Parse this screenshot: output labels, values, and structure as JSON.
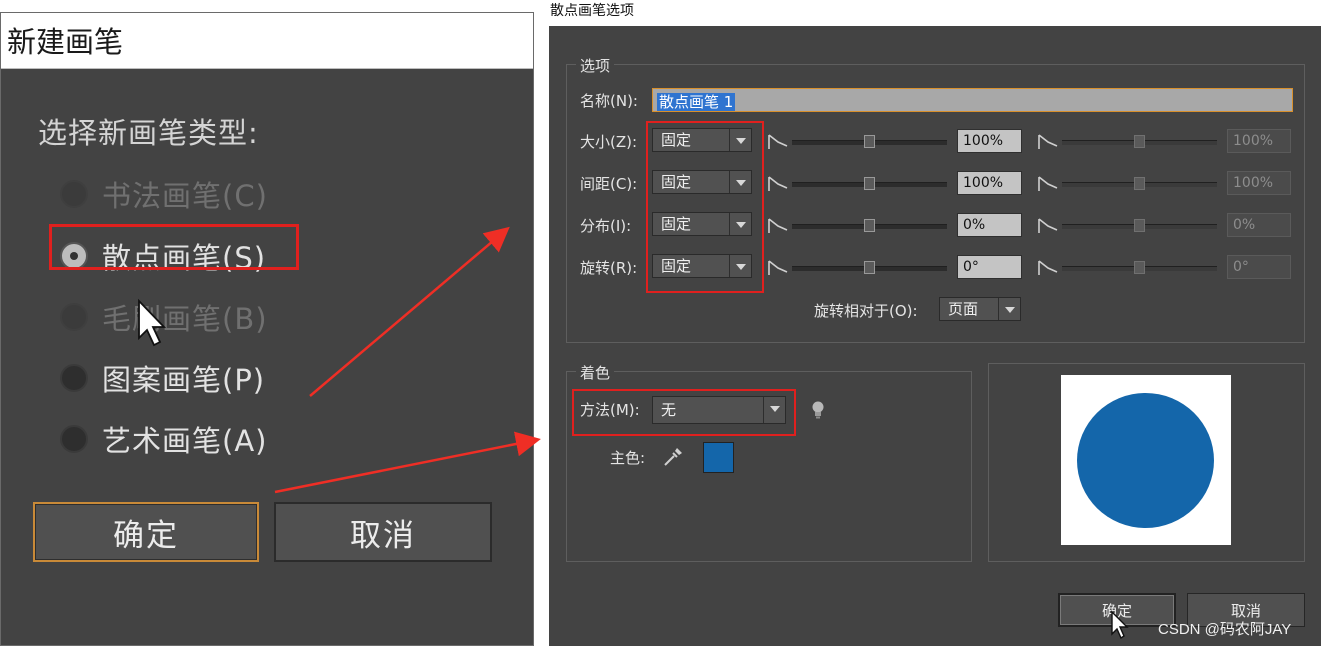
{
  "left_dialog": {
    "title": "新建画笔",
    "prompt": "选择新画笔类型:",
    "options": [
      {
        "label": "书法画笔(C)",
        "checked": false,
        "enabled": false
      },
      {
        "label": "散点画笔(S)",
        "checked": true,
        "enabled": true
      },
      {
        "label": "毛刷画笔(B)",
        "checked": false,
        "enabled": false
      },
      {
        "label": "图案画笔(P)",
        "checked": false,
        "enabled": true
      },
      {
        "label": "艺术画笔(A)",
        "checked": false,
        "enabled": true
      }
    ],
    "ok_label": "确定",
    "cancel_label": "取消"
  },
  "right_dialog": {
    "title": "散点画笔选项",
    "options_legend": "选项",
    "name_label": "名称(N):",
    "name_value": "散点画笔 1",
    "rows": [
      {
        "label": "大小(Z):",
        "mode": "固定",
        "min": "100%",
        "max": "100%"
      },
      {
        "label": "间距(C):",
        "mode": "固定",
        "min": "100%",
        "max": "100%"
      },
      {
        "label": "分布(I):",
        "mode": "固定",
        "min": "0%",
        "max": "0%"
      },
      {
        "label": "旋转(R):",
        "mode": "固定",
        "min": "0°",
        "max": "0°"
      }
    ],
    "rotate_relative_label": "旋转相对于(O):",
    "rotate_relative_value": "页面",
    "colorize_legend": "着色",
    "method_label": "方法(M):",
    "method_value": "无",
    "key_color_label": "主色:",
    "ok_label": "确定",
    "cancel_label": "取消"
  },
  "colors": {
    "dialog_bg": "#434343",
    "key_color": "#1466aa",
    "highlight_red": "#e0201e",
    "focus_orange": "#c98a38"
  },
  "watermark": "CSDN @码农阿JAY"
}
